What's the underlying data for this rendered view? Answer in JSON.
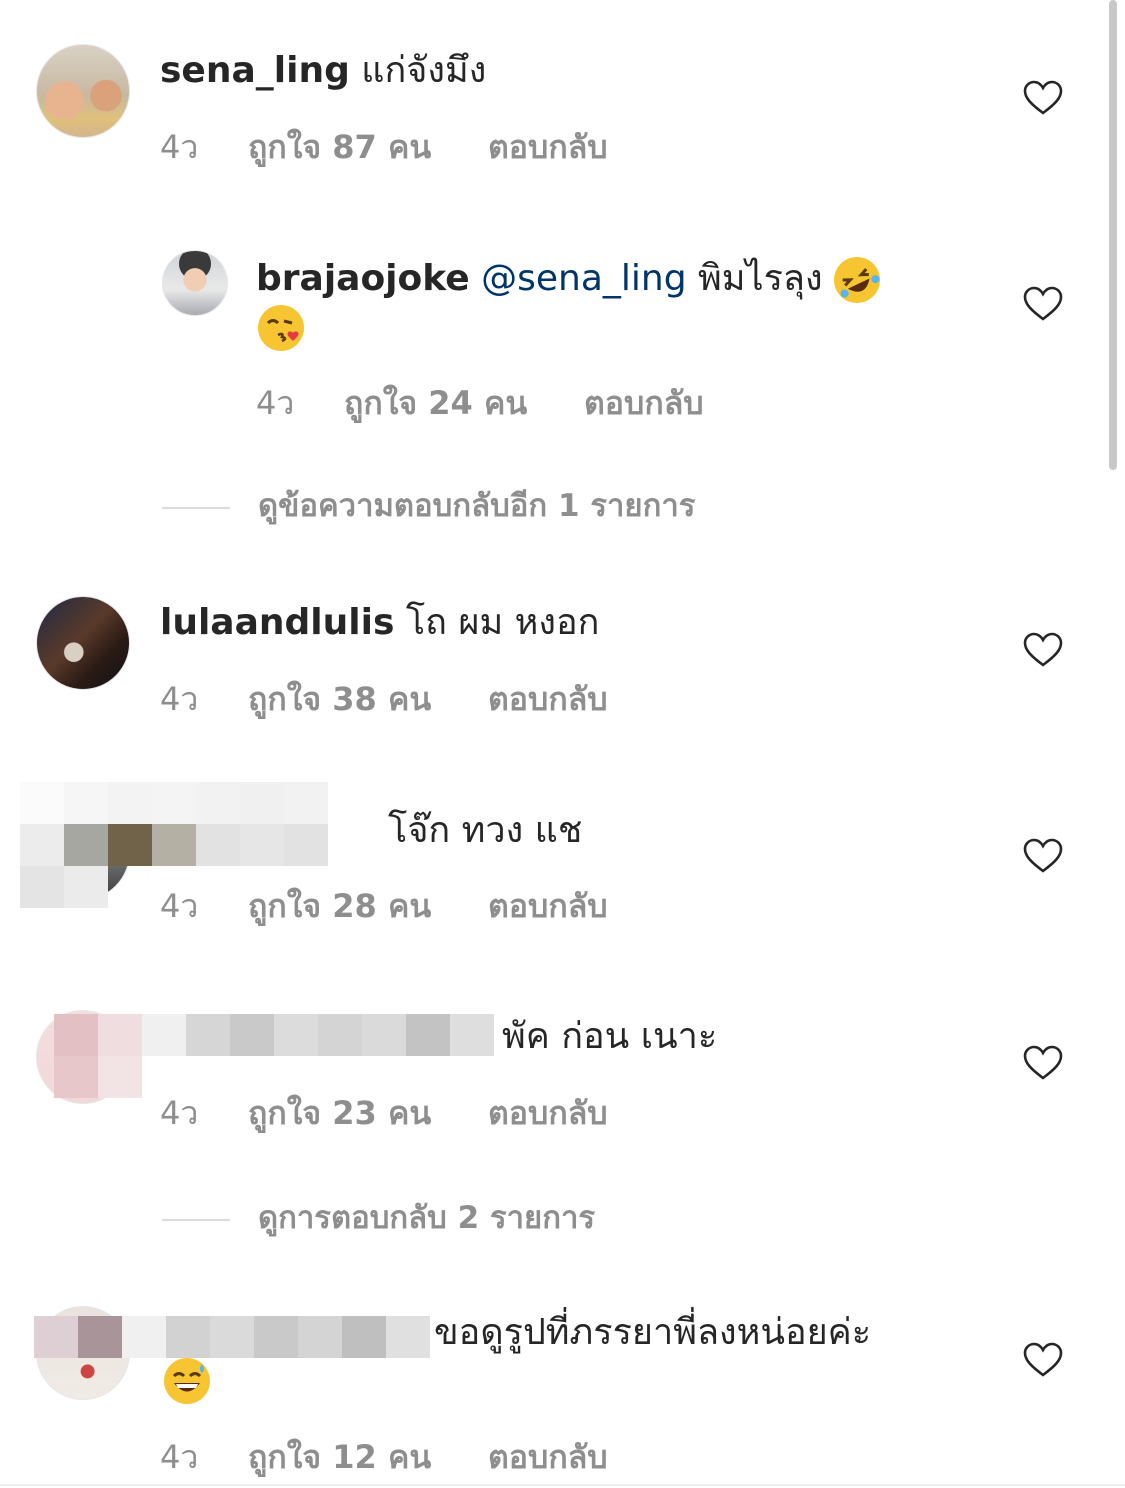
{
  "comments": [
    {
      "username": "sena_ling",
      "text": "แก่จังมึง",
      "time": "4ว",
      "likes": "ถูกใจ 87 คน",
      "reply": "ตอบกลับ"
    },
    {
      "username": "brajaojoke",
      "mention": "@sena_ling",
      "text": "พิมไรลุง",
      "emoji1": "rolling-on-floor-laughing",
      "emoji2": "face-blowing-kiss",
      "time": "4ว",
      "likes": "ถูกใจ 24 คน",
      "reply": "ตอบกลับ"
    },
    {
      "username": "lulaandlulis",
      "text": "โถ ผม หงอก",
      "time": "4ว",
      "likes": "ถูกใจ 38 คน",
      "reply": "ตอบกลับ"
    },
    {
      "text": "โจ๊ก ทวง แช",
      "time": "4ว",
      "likes": "ถูกใจ 28 คน",
      "reply": "ตอบกลับ"
    },
    {
      "text": "พัค ก่อน เนาะ",
      "time": "4ว",
      "likes": "ถูกใจ 23 คน",
      "reply": "ตอบกลับ"
    },
    {
      "text": "ขอดูรูปที่ภรรยาพี่ลงหน่อยค่ะ",
      "emoji": "grinning-face-with-sweat",
      "time": "4ว",
      "likes": "ถูกใจ 12 คน",
      "reply": "ตอบกลับ"
    }
  ],
  "view_more_1": "ดูข้อความตอบกลับอีก 1 รายการ",
  "view_more_2": "ดูการตอบกลับ 2 รายการ",
  "colors": {
    "username": "#262626",
    "mention": "#003569",
    "meta": "#8e8e8e",
    "divider": "#dbdbdb"
  }
}
